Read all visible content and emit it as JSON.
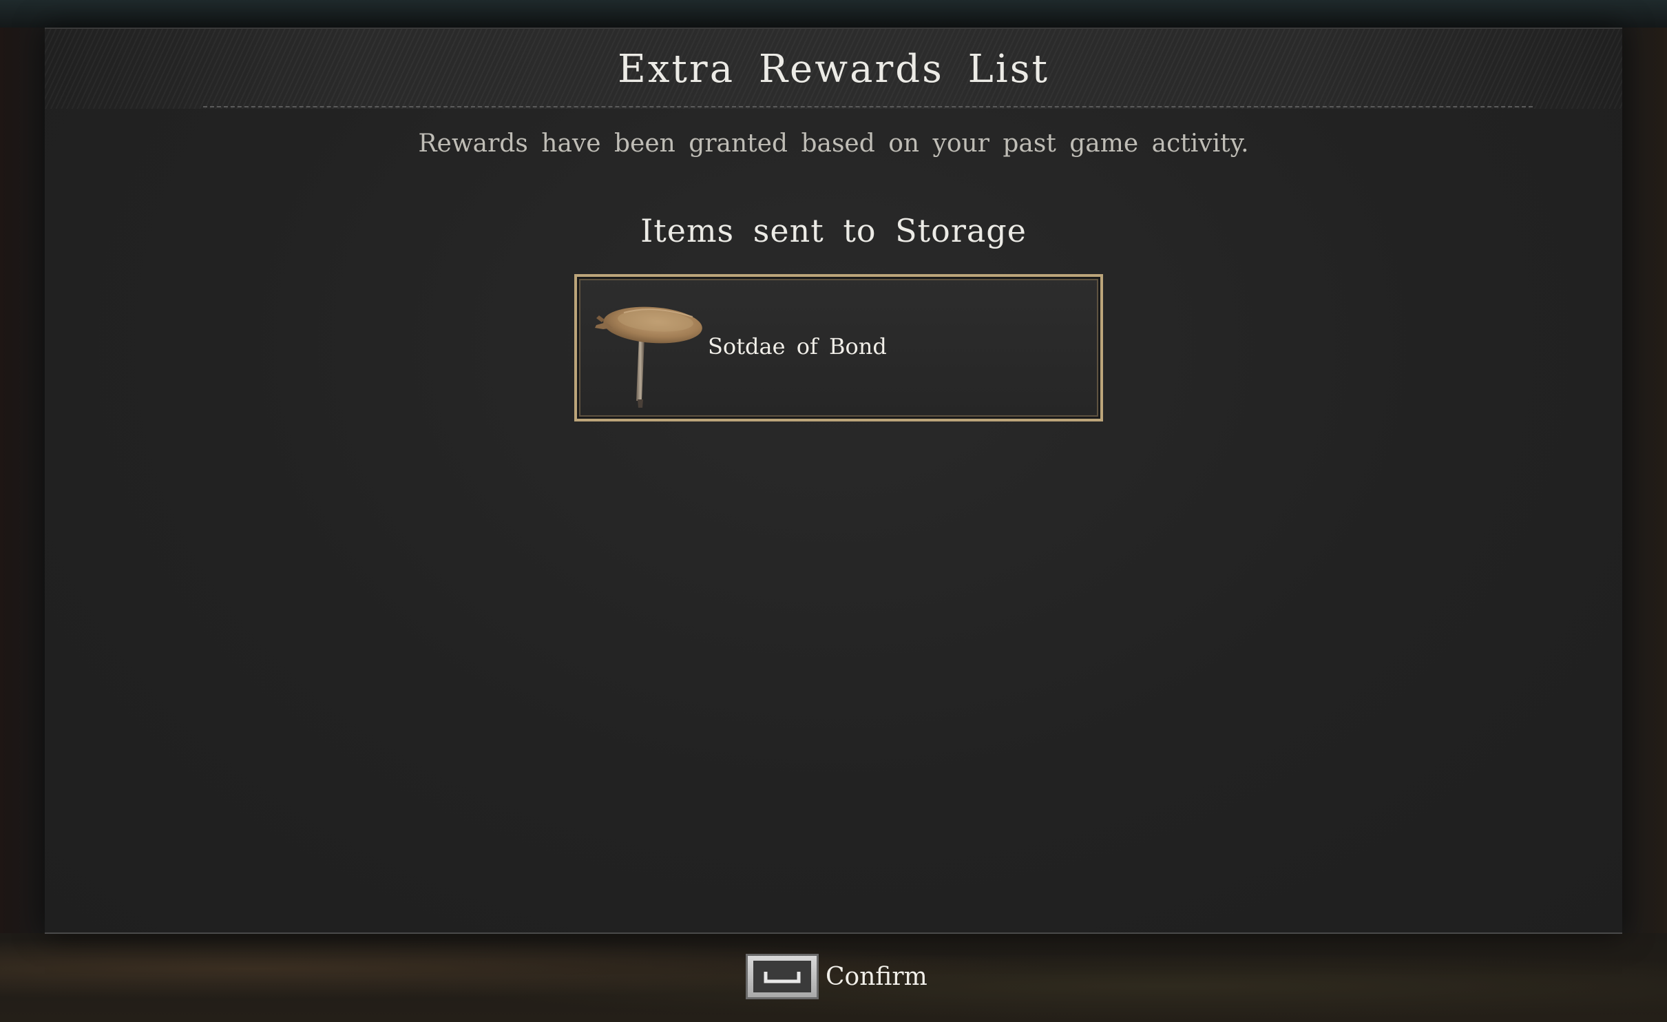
{
  "dialog": {
    "title": "Extra Rewards List",
    "subtitle": "Rewards have been granted based on your past game activity.",
    "section_heading": "Items sent to Storage"
  },
  "rewards": [
    {
      "name": "Sotdae of Bond",
      "icon": "sotdae-pole-icon"
    }
  ],
  "footer": {
    "confirm_label": "Confirm",
    "confirm_key_icon": "spacebar-key-icon"
  },
  "colors": {
    "card_border": "#bca57a",
    "title_text": "#ecebe6",
    "subtitle_text": "#bfbdb6"
  }
}
